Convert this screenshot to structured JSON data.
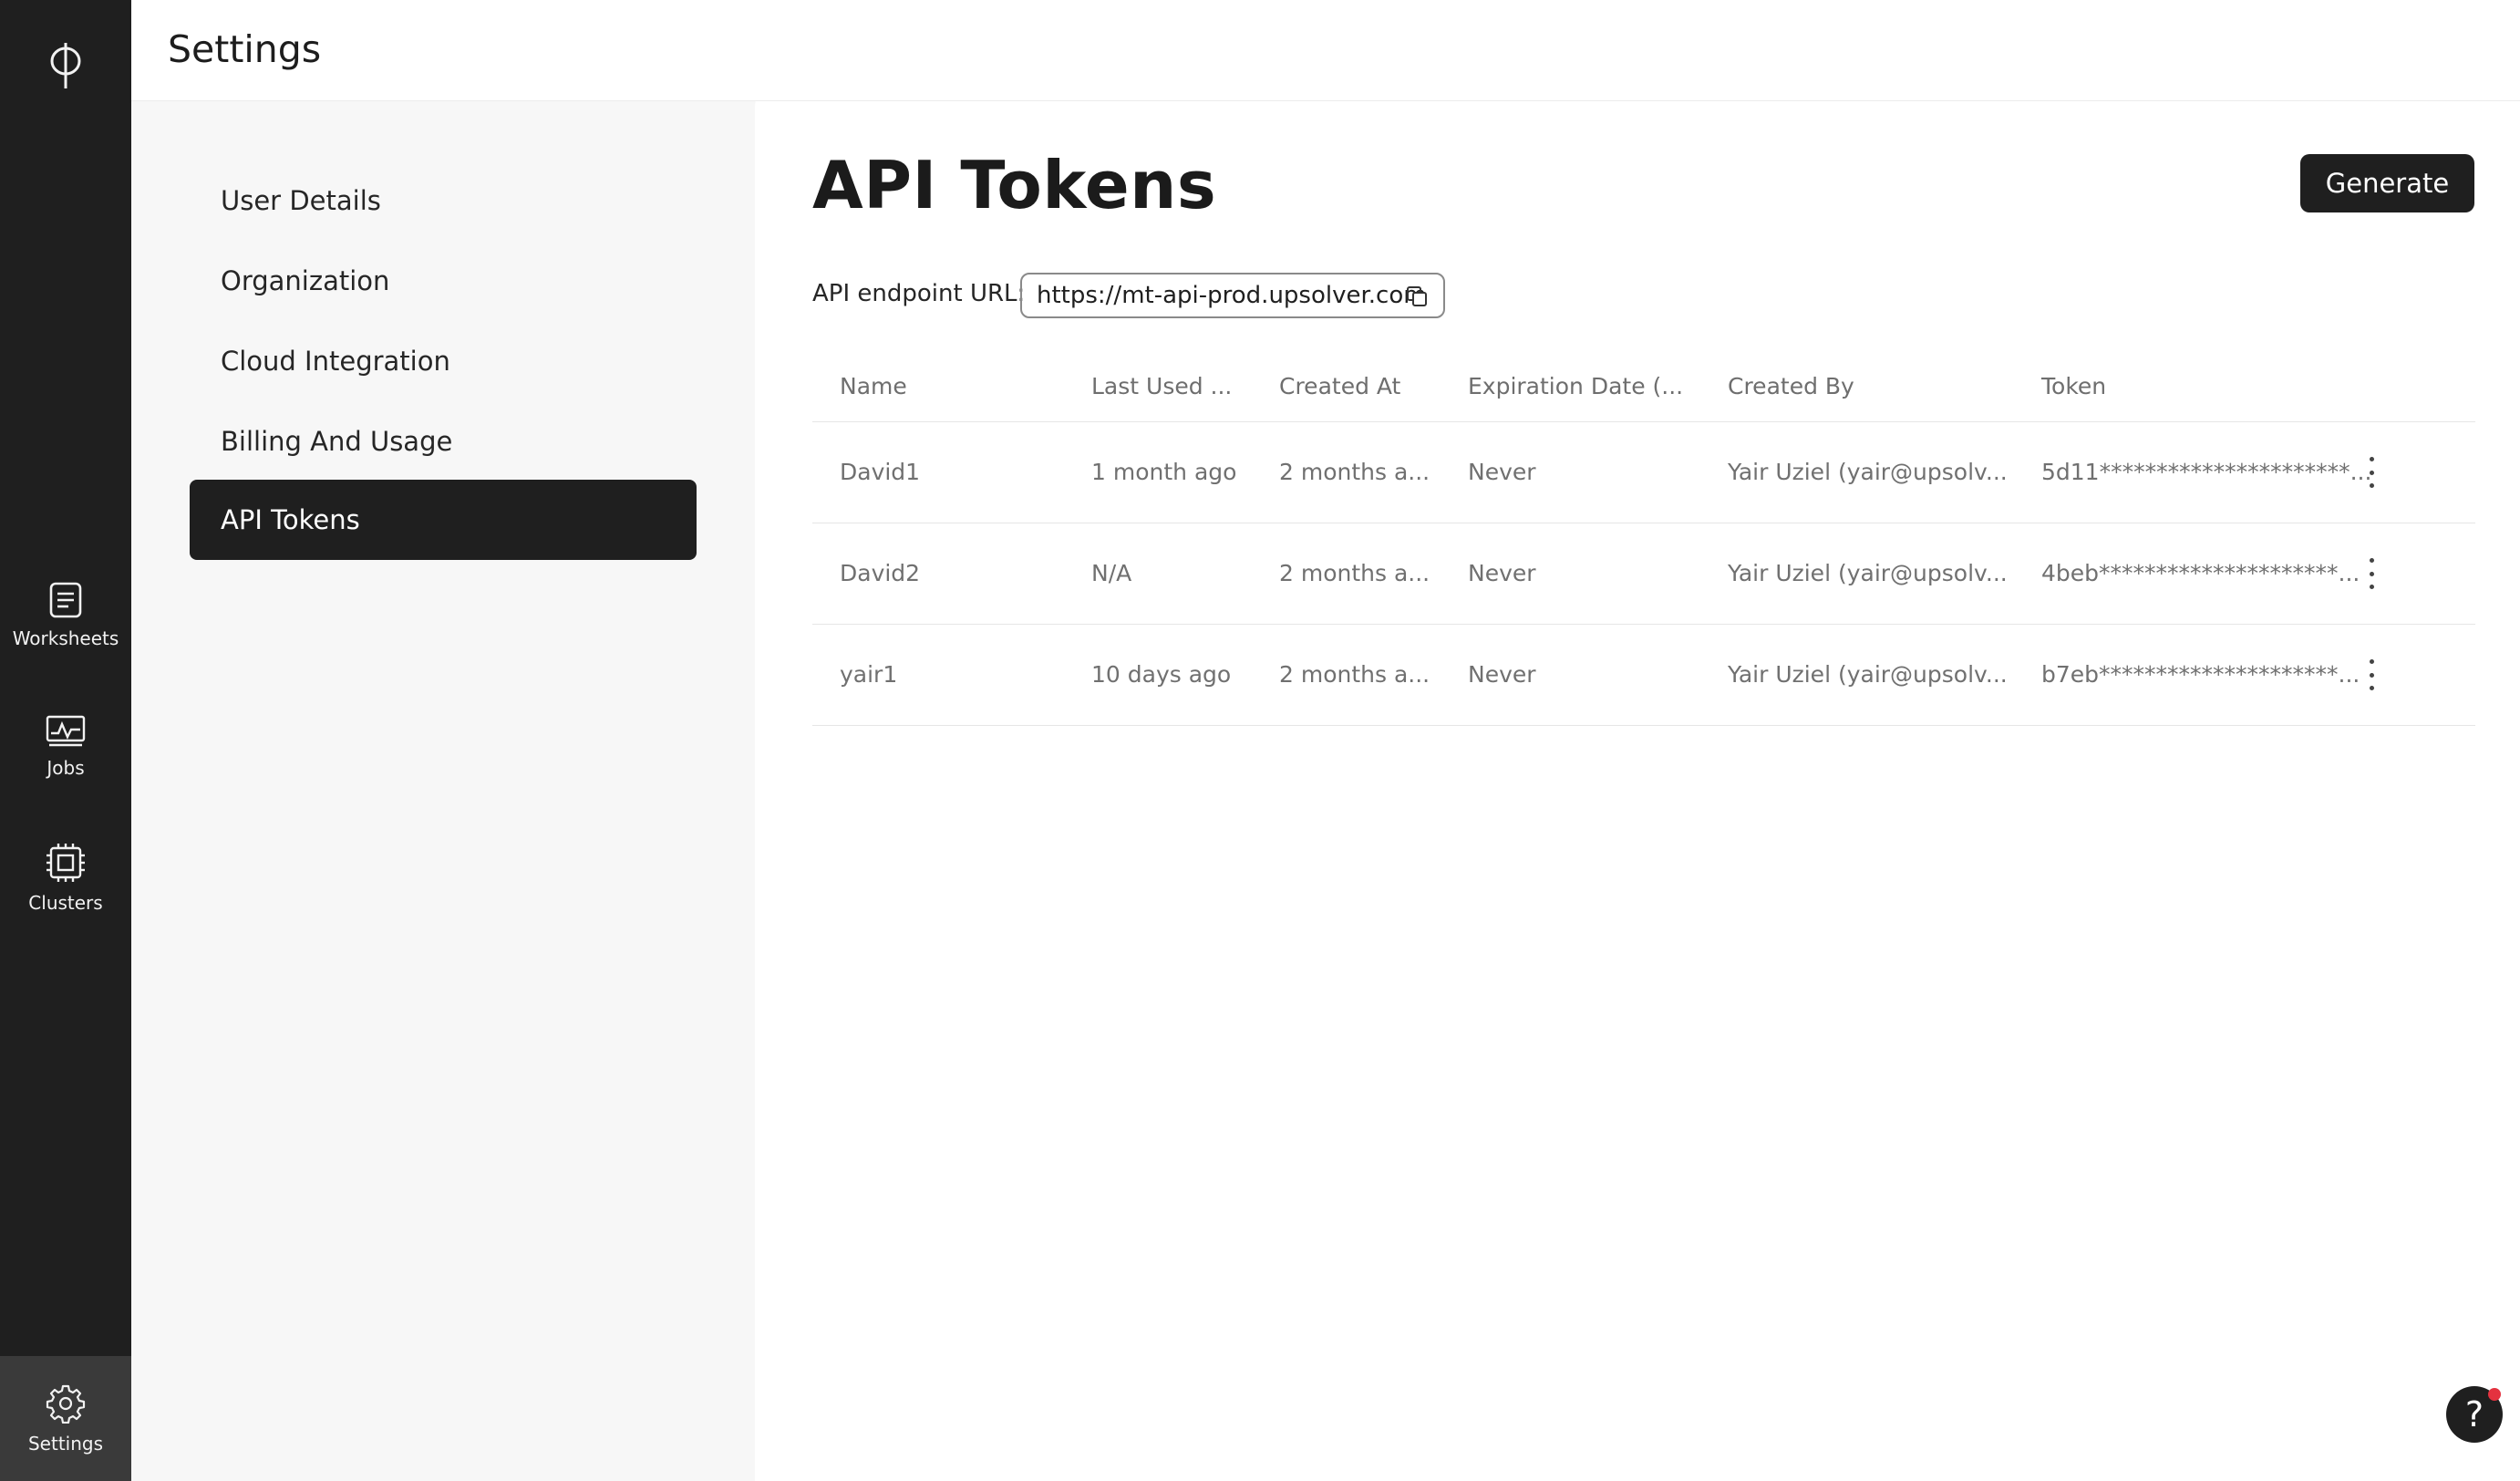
{
  "header": {
    "title": "Settings"
  },
  "rail": {
    "items": [
      {
        "label": "Worksheets",
        "icon": "worksheet-icon"
      },
      {
        "label": "Jobs",
        "icon": "jobs-icon"
      },
      {
        "label": "Clusters",
        "icon": "cluster-icon"
      },
      {
        "label": "Settings",
        "icon": "gear-icon"
      }
    ]
  },
  "side_menu": {
    "items": [
      {
        "label": "User Details"
      },
      {
        "label": "Organization"
      },
      {
        "label": "Cloud Integration"
      },
      {
        "label": "Billing And Usage"
      },
      {
        "label": "API Tokens",
        "active": true
      }
    ]
  },
  "main": {
    "title": "API Tokens",
    "generate_label": "Generate",
    "endpoint_label": "API endpoint URL:",
    "endpoint_url": "https://mt-api-prod.upsolver.com"
  },
  "table": {
    "columns": [
      "Name",
      "Last Used ...",
      "Created At",
      "Expiration Date (...",
      "Created By",
      "Token"
    ],
    "rows": [
      [
        "David1",
        "1 month ago",
        "2 months a...",
        "Never",
        "Yair Uziel (yair@upsolv...",
        "5d11**********************..."
      ],
      [
        "David2",
        "N/A",
        "2 months a...",
        "Never",
        "Yair Uziel (yair@upsolv...",
        "4beb*********************..."
      ],
      [
        "yair1",
        "10 days ago",
        "2 months a...",
        "Never",
        "Yair Uziel (yair@upsolv...",
        "b7eb*********************..."
      ]
    ]
  },
  "help": {
    "label": "?"
  },
  "colors": {
    "rail": "#1f1f1f",
    "accent_dark": "#1f1f1f",
    "side_bg": "#f7f7f7",
    "notification_dot": "#e4323f"
  }
}
